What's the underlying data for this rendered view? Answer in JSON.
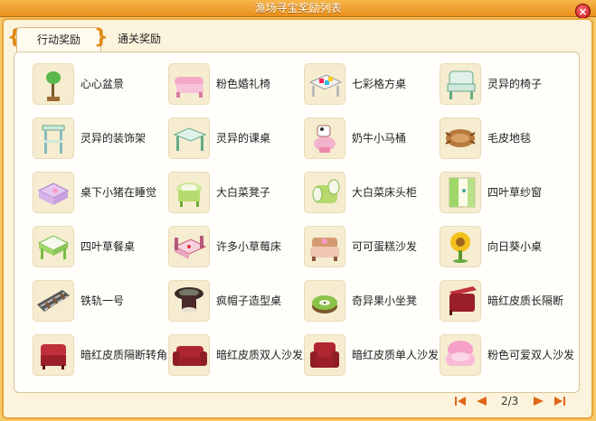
{
  "window": {
    "title": "渔场寻宝奖励列表",
    "close_label": "×"
  },
  "tabs": [
    {
      "label": "行动奖励",
      "active": true
    },
    {
      "label": "通关奖励",
      "active": false
    }
  ],
  "items": [
    {
      "label": "心心盆景",
      "icon": "heart-plant-icon"
    },
    {
      "label": "粉色婚礼椅",
      "icon": "pink-wedding-chair-icon"
    },
    {
      "label": "七彩格方桌",
      "icon": "rainbow-square-table-icon"
    },
    {
      "label": "灵异的椅子",
      "icon": "spooky-chair-icon"
    },
    {
      "label": "灵异的装饰架",
      "icon": "spooky-shelf-icon"
    },
    {
      "label": "灵异的课桌",
      "icon": "spooky-desk-icon"
    },
    {
      "label": "奶牛小马桶",
      "icon": "cow-toilet-icon"
    },
    {
      "label": "毛皮地毯",
      "icon": "fur-rug-icon"
    },
    {
      "label": "桌下小猪在睡觉",
      "icon": "sleeping-pig-table-icon"
    },
    {
      "label": "大白菜凳子",
      "icon": "cabbage-stool-icon"
    },
    {
      "label": "大白菜床头柜",
      "icon": "cabbage-nightstand-icon"
    },
    {
      "label": "四叶草纱窗",
      "icon": "clover-curtain-icon"
    },
    {
      "label": "四叶草餐桌",
      "icon": "clover-dining-table-icon"
    },
    {
      "label": "许多小草莓床",
      "icon": "strawberry-bed-icon"
    },
    {
      "label": "可可蛋糕沙发",
      "icon": "cocoa-cake-sofa-icon"
    },
    {
      "label": "向日葵小桌",
      "icon": "sunflower-table-icon"
    },
    {
      "label": "铁轨一号",
      "icon": "railway-track-icon"
    },
    {
      "label": "疯帽子造型桌",
      "icon": "mad-hat-table-icon"
    },
    {
      "label": "奇异果小坐凳",
      "icon": "kiwi-stool-icon"
    },
    {
      "label": "暗红皮质长隔断",
      "icon": "red-leather-long-partition-icon"
    },
    {
      "label": "暗红皮质隔断转角",
      "icon": "red-leather-corner-partition-icon"
    },
    {
      "label": "暗红皮质双人沙发",
      "icon": "red-leather-loveseat-icon"
    },
    {
      "label": "暗红皮质单人沙发",
      "icon": "red-leather-armchair-icon"
    },
    {
      "label": "粉色可爱双人沙发",
      "icon": "pink-loveseat-icon"
    }
  ],
  "pager": {
    "text": "2/3",
    "current": 2,
    "total": 3
  }
}
